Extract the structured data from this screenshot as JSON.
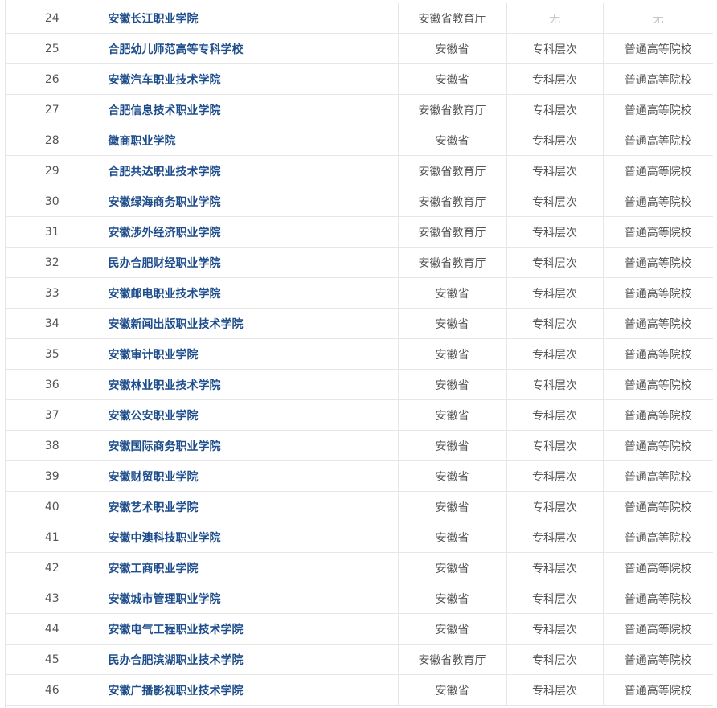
{
  "table": {
    "rows": [
      {
        "index": "24",
        "name": "安徽长江职业学院",
        "authority": "安徽省教育厅",
        "level": "无",
        "type": "无",
        "empty": true
      },
      {
        "index": "25",
        "name": "合肥幼儿师范高等专科学校",
        "authority": "安徽省",
        "level": "专科层次",
        "type": "普通高等院校",
        "empty": false
      },
      {
        "index": "26",
        "name": "安徽汽车职业技术学院",
        "authority": "安徽省",
        "level": "专科层次",
        "type": "普通高等院校",
        "empty": false
      },
      {
        "index": "27",
        "name": "合肥信息技术职业学院",
        "authority": "安徽省教育厅",
        "level": "专科层次",
        "type": "普通高等院校",
        "empty": false
      },
      {
        "index": "28",
        "name": "徽商职业学院",
        "authority": "安徽省",
        "level": "专科层次",
        "type": "普通高等院校",
        "empty": false
      },
      {
        "index": "29",
        "name": "合肥共达职业技术学院",
        "authority": "安徽省教育厅",
        "level": "专科层次",
        "type": "普通高等院校",
        "empty": false
      },
      {
        "index": "30",
        "name": "安徽绿海商务职业学院",
        "authority": "安徽省教育厅",
        "level": "专科层次",
        "type": "普通高等院校",
        "empty": false
      },
      {
        "index": "31",
        "name": "安徽涉外经济职业学院",
        "authority": "安徽省教育厅",
        "level": "专科层次",
        "type": "普通高等院校",
        "empty": false
      },
      {
        "index": "32",
        "name": "民办合肥财经职业学院",
        "authority": "安徽省教育厅",
        "level": "专科层次",
        "type": "普通高等院校",
        "empty": false
      },
      {
        "index": "33",
        "name": "安徽邮电职业技术学院",
        "authority": "安徽省",
        "level": "专科层次",
        "type": "普通高等院校",
        "empty": false
      },
      {
        "index": "34",
        "name": "安徽新闻出版职业技术学院",
        "authority": "安徽省",
        "level": "专科层次",
        "type": "普通高等院校",
        "empty": false
      },
      {
        "index": "35",
        "name": "安徽审计职业学院",
        "authority": "安徽省",
        "level": "专科层次",
        "type": "普通高等院校",
        "empty": false
      },
      {
        "index": "36",
        "name": "安徽林业职业技术学院",
        "authority": "安徽省",
        "level": "专科层次",
        "type": "普通高等院校",
        "empty": false
      },
      {
        "index": "37",
        "name": "安徽公安职业学院",
        "authority": "安徽省",
        "level": "专科层次",
        "type": "普通高等院校",
        "empty": false
      },
      {
        "index": "38",
        "name": "安徽国际商务职业学院",
        "authority": "安徽省",
        "level": "专科层次",
        "type": "普通高等院校",
        "empty": false
      },
      {
        "index": "39",
        "name": "安徽财贸职业学院",
        "authority": "安徽省",
        "level": "专科层次",
        "type": "普通高等院校",
        "empty": false
      },
      {
        "index": "40",
        "name": "安徽艺术职业学院",
        "authority": "安徽省",
        "level": "专科层次",
        "type": "普通高等院校",
        "empty": false
      },
      {
        "index": "41",
        "name": "安徽中澳科技职业学院",
        "authority": "安徽省",
        "level": "专科层次",
        "type": "普通高等院校",
        "empty": false
      },
      {
        "index": "42",
        "name": "安徽工商职业学院",
        "authority": "安徽省",
        "level": "专科层次",
        "type": "普通高等院校",
        "empty": false
      },
      {
        "index": "43",
        "name": "安徽城市管理职业学院",
        "authority": "安徽省",
        "level": "专科层次",
        "type": "普通高等院校",
        "empty": false
      },
      {
        "index": "44",
        "name": "安徽电气工程职业技术学院",
        "authority": "安徽省",
        "level": "专科层次",
        "type": "普通高等院校",
        "empty": false
      },
      {
        "index": "45",
        "name": "民办合肥滨湖职业技术学院",
        "authority": "安徽省教育厅",
        "level": "专科层次",
        "type": "普通高等院校",
        "empty": false
      },
      {
        "index": "46",
        "name": "安徽广播影视职业技术学院",
        "authority": "安徽省",
        "level": "专科层次",
        "type": "普通高等院校",
        "empty": false
      }
    ]
  },
  "colors": {
    "link": "#1f4e8c",
    "text": "#555555",
    "empty_text": "#c8c8c8",
    "border": "#e6e6e6"
  }
}
